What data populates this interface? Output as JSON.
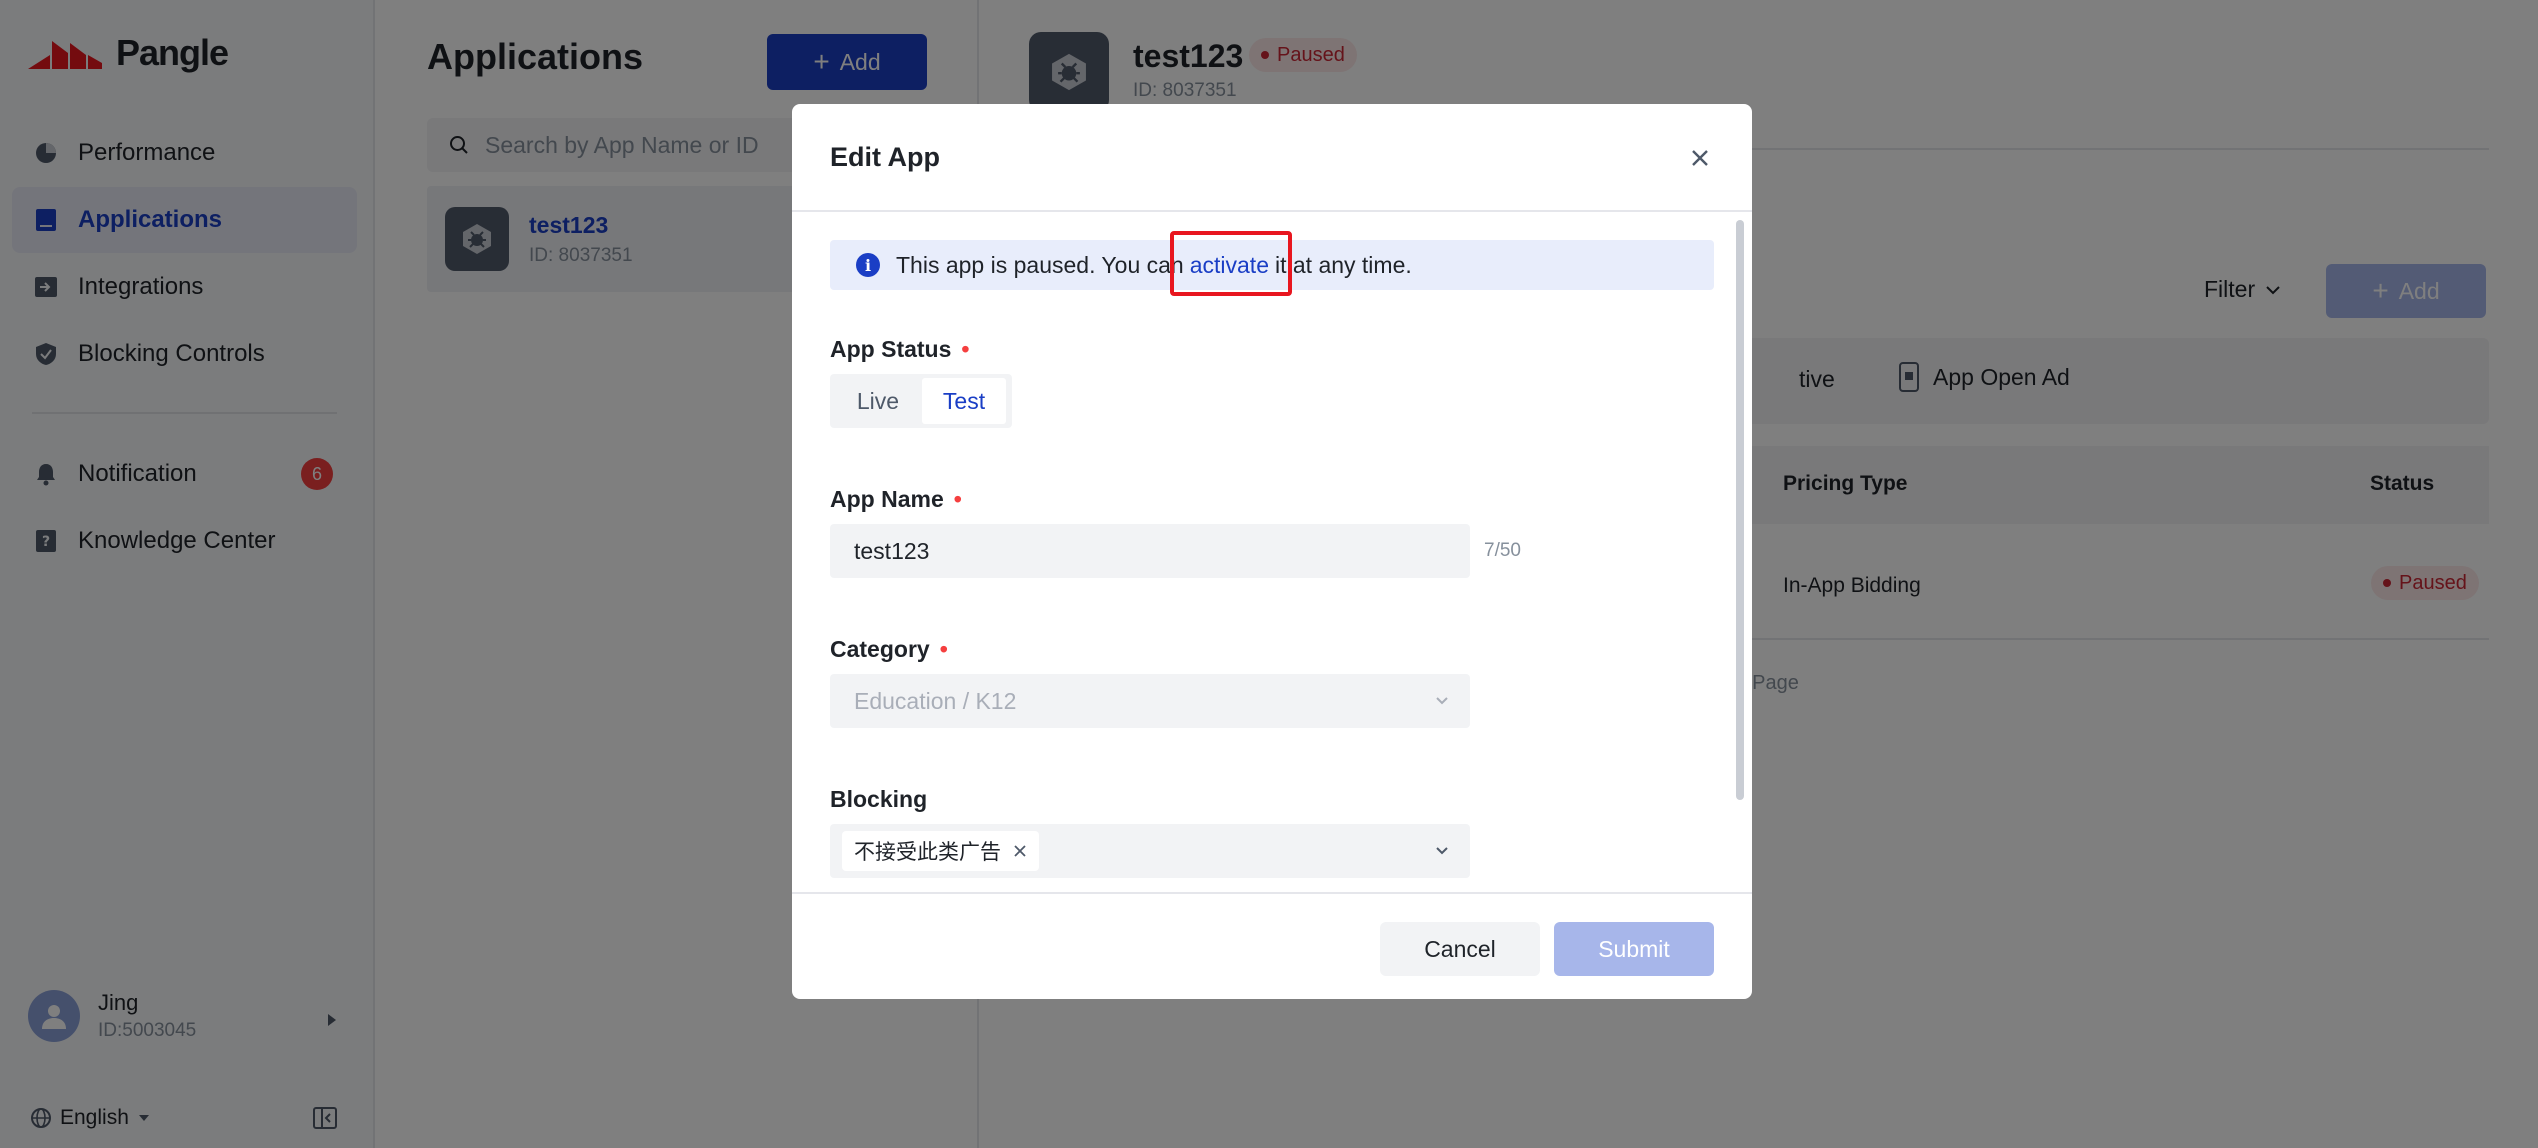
{
  "brand": {
    "name": "Pangle",
    "logo_color": "#e8161f"
  },
  "sidebar": {
    "items": [
      {
        "label": "Performance",
        "icon": "pie-chart-icon"
      },
      {
        "label": "Applications",
        "icon": "app-book-icon",
        "active": true
      },
      {
        "label": "Integrations",
        "icon": "integration-icon"
      },
      {
        "label": "Blocking Controls",
        "icon": "shield-icon"
      },
      {
        "label": "Notification",
        "icon": "bell-icon",
        "badge": "6"
      },
      {
        "label": "Knowledge Center",
        "icon": "help-book-icon"
      }
    ],
    "user": {
      "name": "Jing",
      "id": "ID:5003045"
    },
    "language": "English"
  },
  "applications": {
    "title": "Applications",
    "add_label": "Add",
    "search_placeholder": "Search by App Name or ID",
    "list": [
      {
        "name": "test123",
        "id": "ID: 8037351"
      }
    ]
  },
  "detail": {
    "title": "test123",
    "status": "Paused",
    "id": "ID: 8037351",
    "filter_label": "Filter",
    "add_label": "Add",
    "ad_types": [
      "tive",
      "App Open Ad"
    ],
    "table": {
      "headers": [
        "Pricing Type",
        "Status"
      ],
      "rows": [
        {
          "pricing_type": "In-App Bidding",
          "status": "Paused"
        }
      ]
    },
    "page_note": "f Page"
  },
  "modal": {
    "title": "Edit App",
    "alert": {
      "before": "This app is paused. You can",
      "link": "activate",
      "after": "it at any time."
    },
    "app_status": {
      "label": "App Status",
      "options": [
        "Live",
        "Test"
      ],
      "selected": "Test"
    },
    "app_name": {
      "label": "App Name",
      "value": "test123",
      "counter": "7/50"
    },
    "category": {
      "label": "Category",
      "value": "Education / K12"
    },
    "blocking": {
      "label": "Blocking",
      "chips": [
        "不接受此类广告"
      ]
    },
    "cancel_label": "Cancel",
    "submit_label": "Submit"
  },
  "colors": {
    "primary": "#1a3ec5",
    "primary_disabled": "#a7b6ea",
    "danger": "#f53f3f",
    "paused_text": "#cb2634",
    "highlight_box": "#e8161f"
  }
}
